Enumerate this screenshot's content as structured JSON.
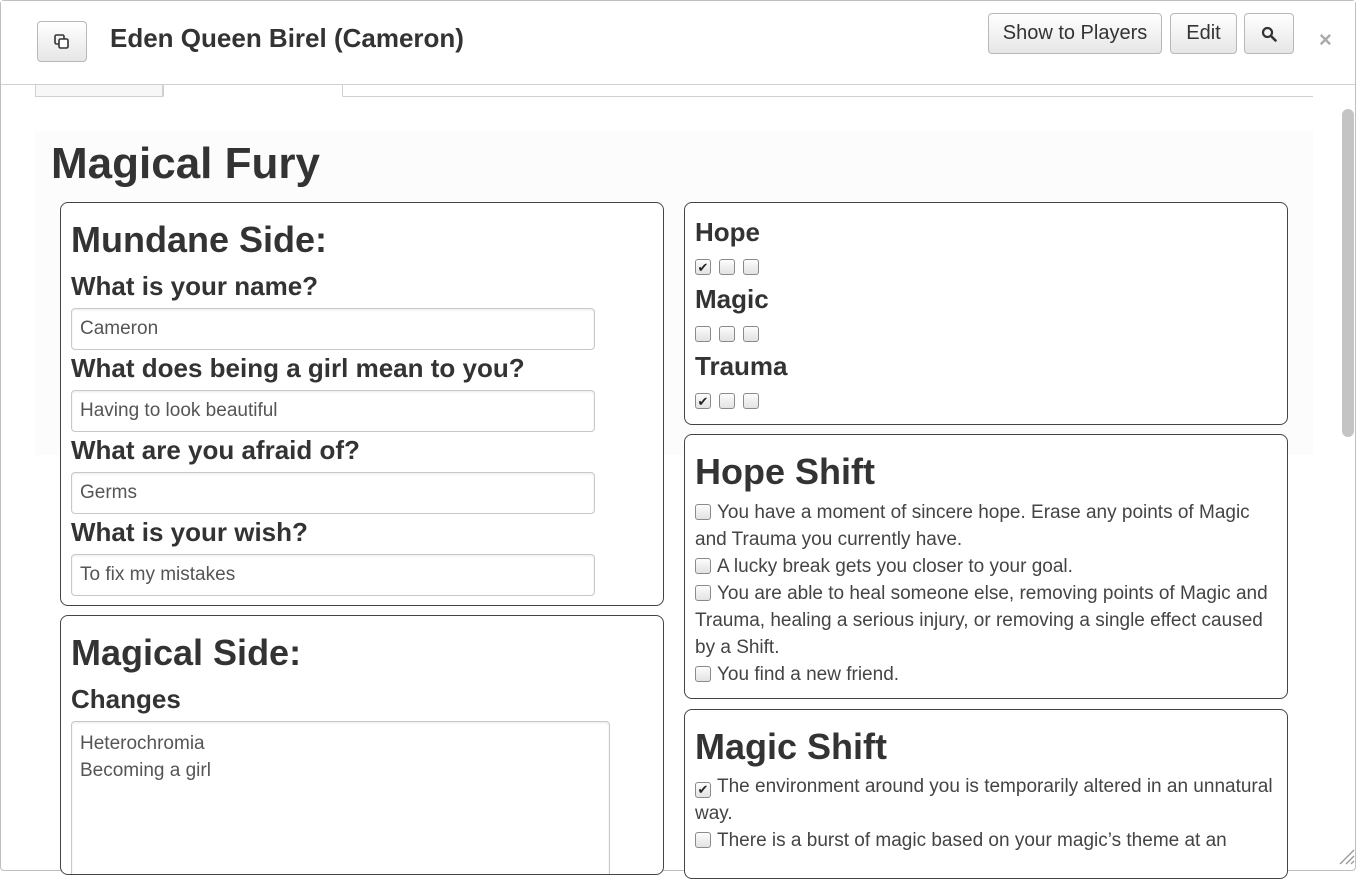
{
  "window": {
    "title": "Eden Queen Birel (Cameron)",
    "show_players_label": "Show to Players",
    "edit_label": "Edit",
    "close_glyph": "×"
  },
  "sheet": {
    "title": "Magical Fury"
  },
  "mundane": {
    "heading": "Mundane Side:",
    "questions": [
      {
        "label": "What is your name?",
        "value": "Cameron"
      },
      {
        "label": "What does being a girl mean to you?",
        "value": "Having to look beautiful"
      },
      {
        "label": "What are you afraid of?",
        "value": "Germs"
      },
      {
        "label": "What is your wish?",
        "value": "To fix my mistakes"
      }
    ]
  },
  "magical": {
    "heading": "Magical Side:",
    "changes_label": "Changes",
    "changes_value": "Heterochromia\nBecoming a girl"
  },
  "stats": [
    {
      "label": "Hope",
      "boxes": [
        true,
        false,
        false
      ]
    },
    {
      "label": "Magic",
      "boxes": [
        false,
        false,
        false
      ]
    },
    {
      "label": "Trauma",
      "boxes": [
        true,
        false,
        false
      ]
    }
  ],
  "hope_shift": {
    "heading": "Hope Shift",
    "items": [
      {
        "checked": false,
        "text": "You have a moment of sincere hope. Erase any points of Magic and Trauma you currently have."
      },
      {
        "checked": false,
        "text": "A lucky break gets you closer to your goal."
      },
      {
        "checked": false,
        "text": "You are able to heal someone else, removing points of Magic and Trauma, healing a serious injury, or removing a single effect caused by a Shift."
      },
      {
        "checked": false,
        "text": "You find a new friend."
      }
    ]
  },
  "magic_shift": {
    "heading": "Magic Shift",
    "items": [
      {
        "checked": true,
        "text": "The environment around you is temporarily altered in an unnatural way."
      },
      {
        "checked": false,
        "text": "There is a burst of magic based on your magic’s theme at an"
      }
    ]
  },
  "icons": {
    "popout": "popout-icon",
    "search": "search-icon",
    "close": "close-icon",
    "resize": "resize-handle-icon",
    "check": "✔"
  }
}
